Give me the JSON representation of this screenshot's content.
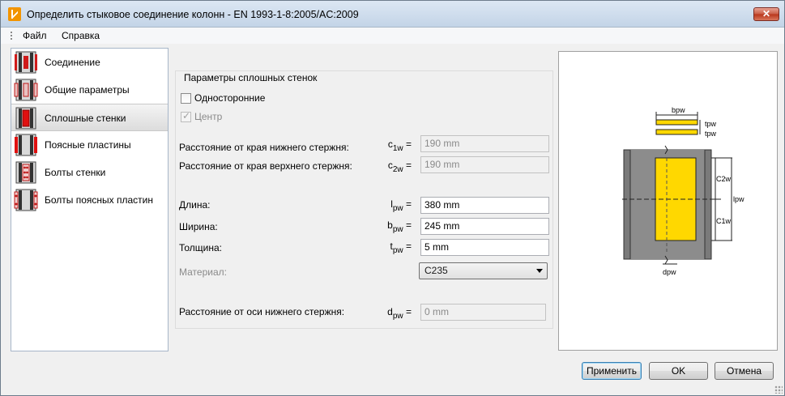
{
  "window": {
    "title": "Определить стыковое соединение колонн - EN 1993-1-8:2005/AC:2009",
    "close_label": "✕"
  },
  "menu": {
    "items": [
      "Файл",
      "Справка"
    ]
  },
  "nav": {
    "items": [
      {
        "label": "Соединение",
        "icon": "column-splice-icon"
      },
      {
        "label": "Общие параметры",
        "icon": "general-parameters-icon"
      },
      {
        "label": "Сплошные стенки",
        "icon": "web-plates-icon"
      },
      {
        "label": "Поясные пластины",
        "icon": "flange-plates-icon"
      },
      {
        "label": "Болты стенки",
        "icon": "web-bolts-icon"
      },
      {
        "label": "Болты поясных пластин",
        "icon": "flange-bolts-icon"
      }
    ],
    "selected_index": 2
  },
  "params": {
    "group_title": "Параметры сплошных стенок",
    "one_sided_label": "Односторонние",
    "center_label": "Центр",
    "c1w": {
      "label": "Расстояние от края нижнего стержня:",
      "symbol": "c",
      "sub": "1w",
      "value": "190 mm"
    },
    "c2w": {
      "label": "Расстояние от края верхнего стержня:",
      "symbol": "c",
      "sub": "2w",
      "value": "190 mm"
    },
    "length": {
      "label": "Длина:",
      "symbol": "l",
      "sub": "pw",
      "value": "380 mm"
    },
    "width": {
      "label": "Ширина:",
      "symbol": "b",
      "sub": "pw",
      "value": "245 mm"
    },
    "thickness": {
      "label": "Толщина:",
      "symbol": "t",
      "sub": "pw",
      "value": "5 mm"
    },
    "material": {
      "label": "Материал:",
      "value": "C235"
    },
    "dpw": {
      "label": "Расстояние от оси нижнего стержня:",
      "symbol": "d",
      "sub": "pw",
      "value": "0 mm"
    }
  },
  "diagram": {
    "labels": {
      "bpw": "bpw",
      "tpw1": "tpw",
      "tpw2": "tpw",
      "c2w": "C2w",
      "lpw": "lpw",
      "c1w": "C1w",
      "dpw": "dpw"
    },
    "plate_color": "#ffd800"
  },
  "buttons": {
    "apply": "Применить",
    "ok": "OK",
    "cancel": "Отмена"
  }
}
